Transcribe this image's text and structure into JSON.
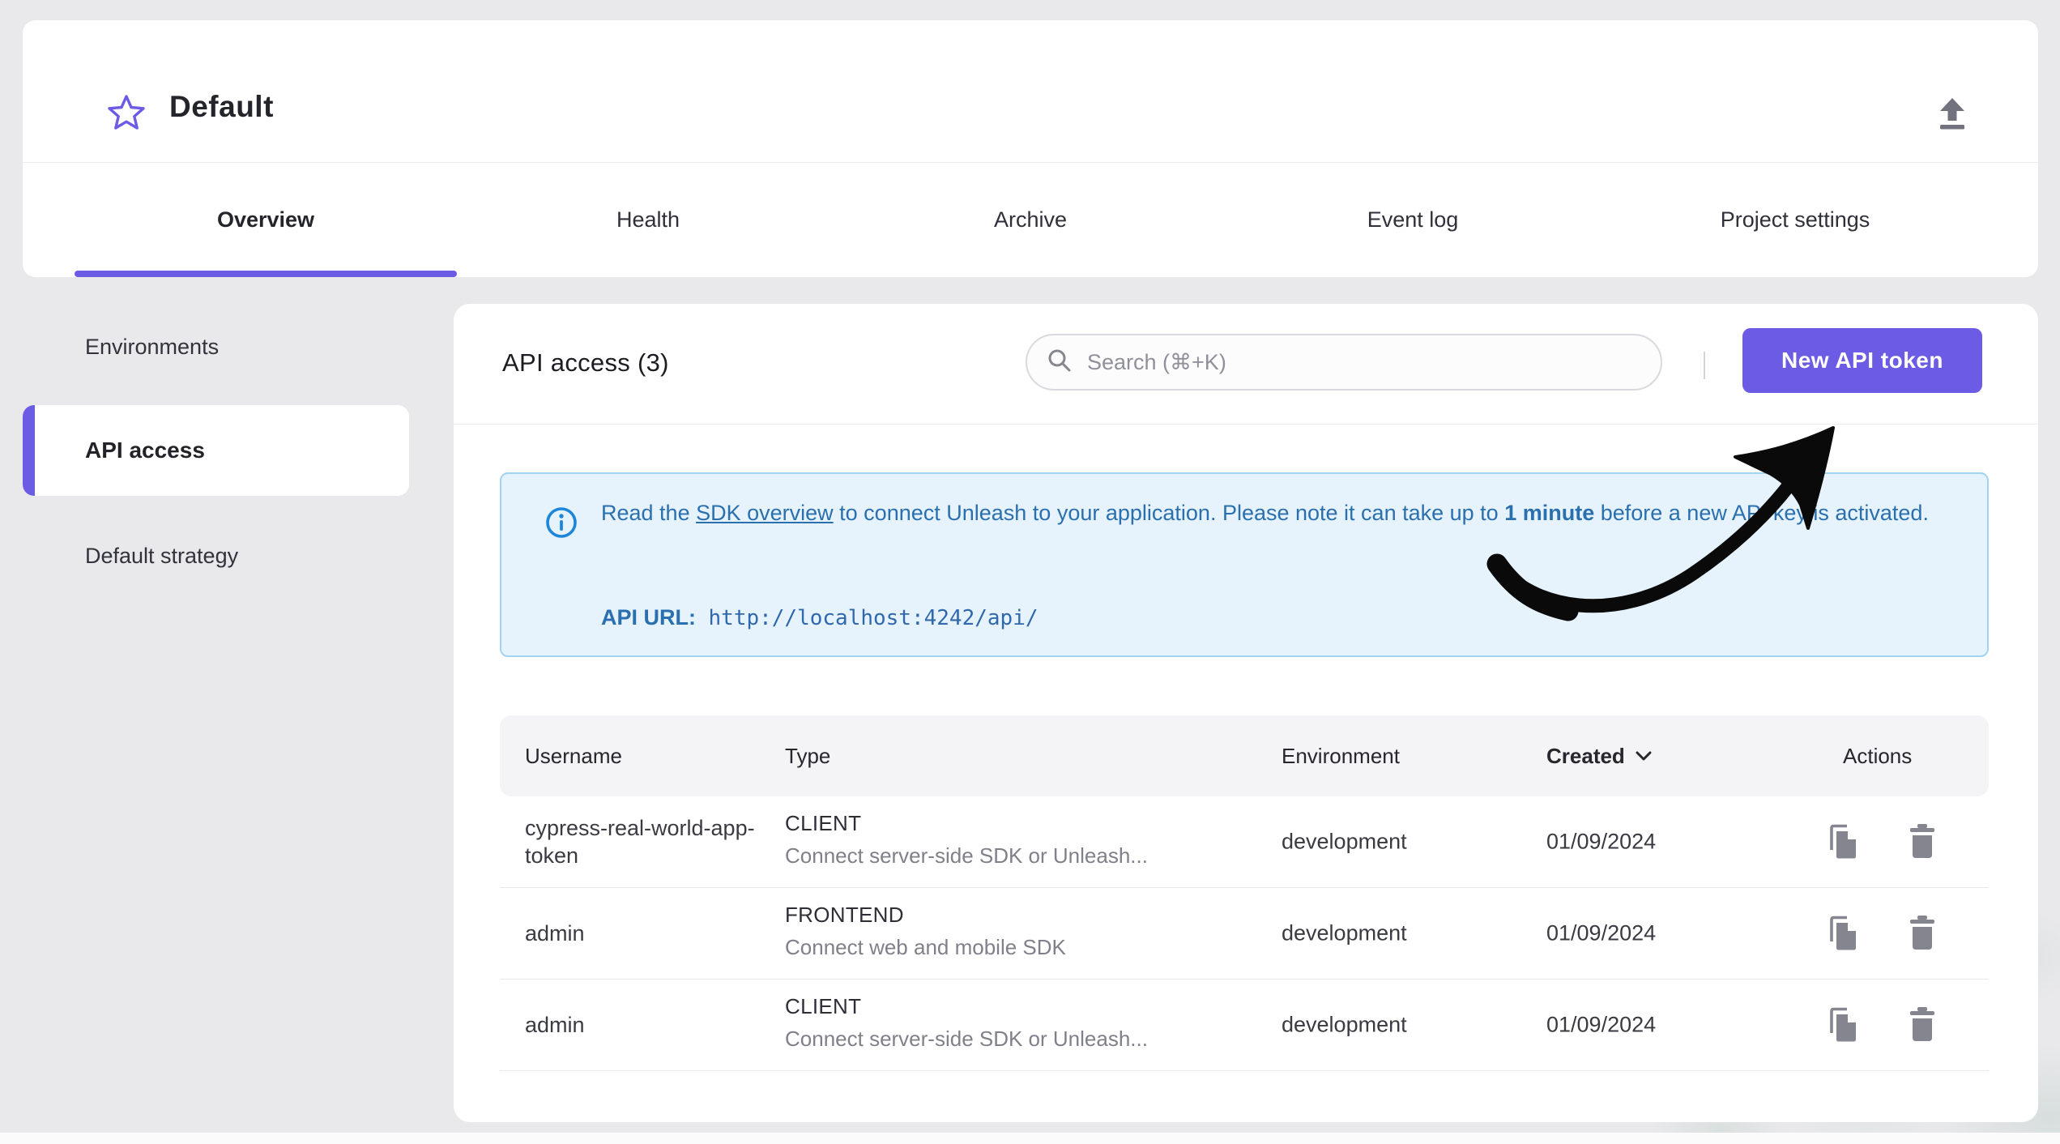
{
  "header": {
    "title": "Default",
    "tabs": [
      {
        "label": "Overview",
        "active": true
      },
      {
        "label": "Health",
        "active": false
      },
      {
        "label": "Archive",
        "active": false
      },
      {
        "label": "Event log",
        "active": false
      },
      {
        "label": "Project settings",
        "active": false
      }
    ]
  },
  "sidebar": {
    "items": [
      {
        "label": "Environments",
        "active": false
      },
      {
        "label": "API access",
        "active": true
      },
      {
        "label": "Default strategy",
        "active": false
      }
    ]
  },
  "main": {
    "title": "API access (3)",
    "search": {
      "placeholder": "Search (⌘+K)"
    },
    "new_token_button": "New API token",
    "alert": {
      "prefix": "Read the ",
      "link": "SDK overview",
      "middle": " to connect Unleash to your application. Please note it can take up to ",
      "bold": "1 minute",
      "suffix": " before a new API key is activated.",
      "api_url_label": "API URL:",
      "api_url": "http://localhost:4242/api/"
    },
    "table": {
      "columns": [
        "Username",
        "Type",
        "Environment",
        "Created",
        "Actions"
      ],
      "rows": [
        {
          "username": "cypress-real-world-app-token",
          "type": "CLIENT",
          "type_desc": "Connect server-side SDK or Unleash...",
          "environment": "development",
          "created": "01/09/2024"
        },
        {
          "username": "admin",
          "type": "FRONTEND",
          "type_desc": "Connect web and mobile SDK",
          "environment": "development",
          "created": "01/09/2024"
        },
        {
          "username": "admin",
          "type": "CLIENT",
          "type_desc": "Connect server-side SDK or Unleash...",
          "environment": "development",
          "created": "01/09/2024"
        }
      ]
    }
  },
  "colors": {
    "accent": "#6c5ce5",
    "page_bg": "#e9e9eb",
    "alert_bg": "#e6f3fc",
    "alert_border": "#a3d3f0",
    "alert_text": "#2a6fae",
    "info_icon": "#1d86d8",
    "icon_gray": "#85858f"
  }
}
